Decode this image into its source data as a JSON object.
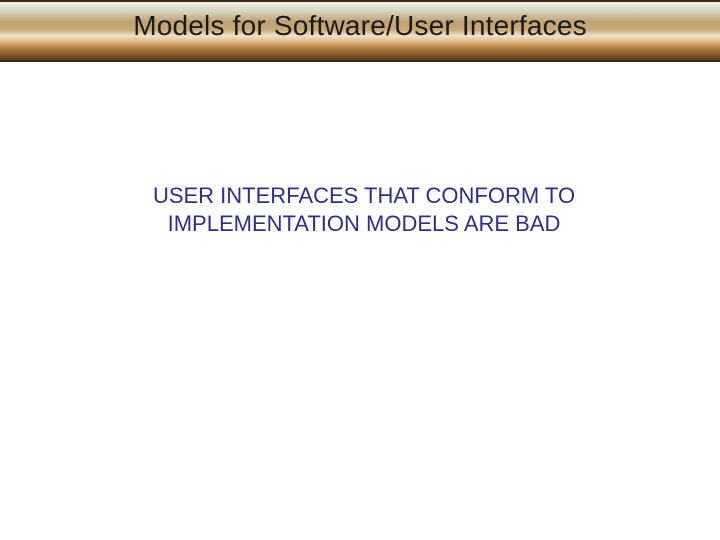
{
  "slide": {
    "title": "Models for Software/User Interfaces",
    "body_line1": "USER INTERFACES THAT CONFORM TO",
    "body_line2": "IMPLEMENTATION MODELS ARE BAD"
  }
}
